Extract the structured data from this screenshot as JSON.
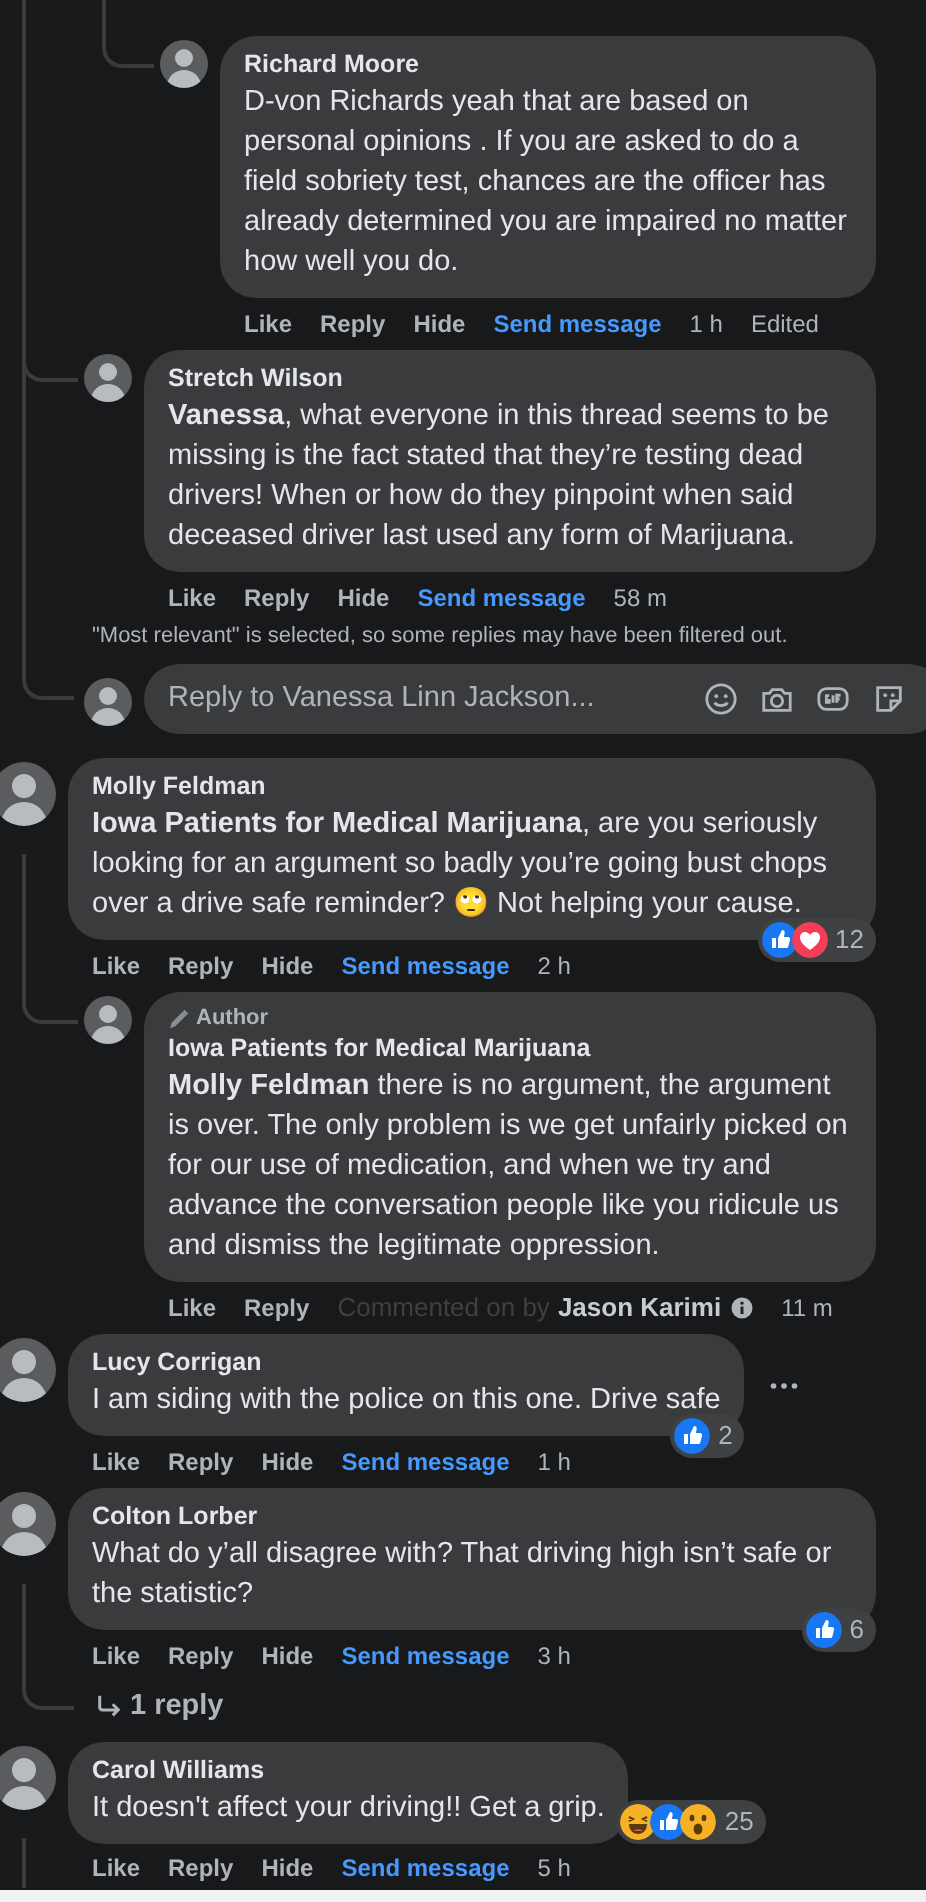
{
  "thread": {
    "nested_replies": [
      {
        "author": "Richard Moore",
        "text": "D-von Richards yeah that are based on personal opinions . If you are asked to do a field sobriety test, chances are the officer has already determined you are impaired no matter how well you do.",
        "actions": [
          {
            "label": "Like",
            "kind": "plain"
          },
          {
            "label": "Reply",
            "kind": "plain"
          },
          {
            "label": "Hide",
            "kind": "plain"
          },
          {
            "label": "Send message",
            "kind": "message"
          }
        ],
        "time": "1 h",
        "edited": "Edited"
      }
    ],
    "replies": [
      {
        "author": "Stretch Wilson",
        "text": "**Vanessa**, what everyone in this thread seems to be missing is the fact stated that they’re testing dead drivers! When or how do they pinpoint when said deceased driver last used any form of Marijuana.",
        "actions": [
          {
            "label": "Like",
            "kind": "plain"
          },
          {
            "label": "Reply",
            "kind": "plain"
          },
          {
            "label": "Hide",
            "kind": "plain"
          },
          {
            "label": "Send message",
            "kind": "message"
          }
        ],
        "time": "58 m"
      }
    ],
    "filter_note": "\"Most relevant\" is selected, so some replies may have been filtered out.",
    "reply_box": {
      "placeholder": "Reply to Vanessa Linn Jackson..."
    }
  },
  "comments": [
    {
      "author": "Molly Feldman",
      "text": "**Iowa Patients for Medical Marijuana**, are you seriously looking for an argument so badly you’re going bust chops over a drive safe reminder? 🙄 Not helping your cause.",
      "actions": [
        {
          "label": "Like",
          "kind": "plain"
        },
        {
          "label": "Reply",
          "kind": "plain"
        },
        {
          "label": "Hide",
          "kind": "plain"
        },
        {
          "label": "Send message",
          "kind": "message"
        }
      ],
      "time": "2 h",
      "reactions": {
        "icons": [
          {
            "kind": "like"
          },
          {
            "kind": "love"
          }
        ],
        "count": "12"
      },
      "children": [
        {
          "badge": "Author",
          "author": "Iowa Patients for Medical Marijuana",
          "text": "**Molly Feldman** there is no argument, the argument is over. The only problem is we get unfairly picked on for our use of medication, and when we try and advance the conversation people like you ridicule us and dismiss the legitimate oppression.",
          "actions": [
            {
              "label": "Like",
              "kind": "plain"
            },
            {
              "label": "Reply",
              "kind": "plain"
            }
          ],
          "commented_by": {
            "prefix": "Commented on by",
            "name": "Jason Karimi"
          },
          "time": "11 m"
        }
      ]
    },
    {
      "author": "Lucy Corrigan",
      "text": "I am siding with the police on this one. Drive safe",
      "actions": [
        {
          "label": "Like",
          "kind": "plain"
        },
        {
          "label": "Reply",
          "kind": "plain"
        },
        {
          "label": "Hide",
          "kind": "plain"
        },
        {
          "label": "Send message",
          "kind": "message"
        }
      ],
      "time": "1 h",
      "reactions": {
        "icons": [
          {
            "kind": "like"
          }
        ],
        "count": "2"
      },
      "more_options": true
    },
    {
      "author": "Colton Lorber",
      "text": "What do y’all disagree with? That driving high isn’t safe or the statistic?",
      "actions": [
        {
          "label": "Like",
          "kind": "plain"
        },
        {
          "label": "Reply",
          "kind": "plain"
        },
        {
          "label": "Hide",
          "kind": "plain"
        },
        {
          "label": "Send message",
          "kind": "message"
        }
      ],
      "time": "3 h",
      "reactions": {
        "icons": [
          {
            "kind": "like"
          }
        ],
        "count": "6"
      },
      "more_replies": "1 reply"
    },
    {
      "author": "Carol Williams",
      "text": "It doesn't affect your driving!! Get a grip.",
      "actions": [
        {
          "label": "Like",
          "kind": "plain"
        },
        {
          "label": "Reply",
          "kind": "plain"
        },
        {
          "label": "Hide",
          "kind": "plain"
        },
        {
          "label": "Send message",
          "kind": "message"
        }
      ],
      "time": "5 h",
      "reactions": {
        "icons": [
          {
            "kind": "haha"
          },
          {
            "kind": "like"
          },
          {
            "kind": "wow"
          }
        ],
        "count": "25"
      },
      "thread_continues": true
    }
  ]
}
